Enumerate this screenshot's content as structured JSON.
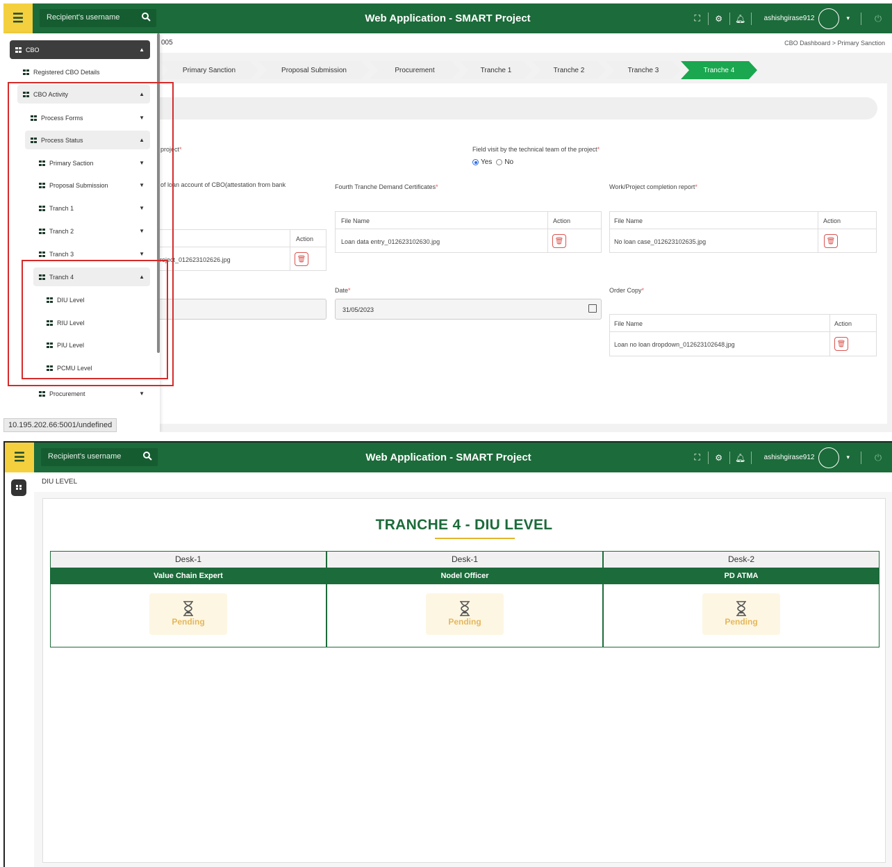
{
  "app": {
    "title": "Web Application - SMART Project",
    "search_placeholder": "Recipient's username",
    "username": "ashishgirase912"
  },
  "screen1": {
    "breadcrumb_left": "005",
    "breadcrumb_right": "CBO Dashboard  >  Primary Sanction",
    "steps": [
      "Primary Sanction",
      "Proposal Submission",
      "Procurement",
      "Tranche 1",
      "Tranche 2",
      "Tranche 3",
      "Tranche 4"
    ],
    "active_step": "Tranche 4",
    "fields": {
      "project_label_partial": "project",
      "field_visit_label": "Field visit by the technical team of the project",
      "radio_yes": "Yes",
      "radio_no": "No",
      "loan_account_label_partial": "of loan account of CBO(attestation from bank",
      "fourth_tranche_label": "Fourth Tranche Demand Certificates",
      "completion_report_label": "Work/Project completion report",
      "date_label": "Date",
      "date_value": "31/05/2023",
      "order_copy_label": "Order Copy"
    },
    "tables": {
      "col_file_name": "File Name",
      "col_action": "Action",
      "left_file_partial": "roject_012623102626.jpg",
      "fourth_tranche_file": "Loan data entry_012623102630.jpg",
      "completion_file": "No loan case_012623102635.jpg",
      "order_copy_file": "Loan no loan dropdown_012623102648.jpg"
    },
    "sidebar": {
      "cbo": "CBO",
      "registered": "Registered CBO Details",
      "activity": "CBO Activity",
      "process_forms": "Process Forms",
      "process_status": "Process Status",
      "primary_saction": "Primary Saction",
      "proposal_submission": "Proposal Submission",
      "tranch1": "Tranch 1",
      "tranch2": "Tranch 2",
      "tranch3": "Tranch 3",
      "tranch4": "Tranch 4",
      "diu": "DIU Level",
      "riu": "RIU Level",
      "piu": "PIU Level",
      "pcmu": "PCMU Level",
      "procurement": "Procurement"
    },
    "status_url": "10.195.202.66:5001/undefined"
  },
  "screen2": {
    "page_header": "DIU LEVEL",
    "title": "TRANCHE 4 - DIU LEVEL",
    "desks": [
      {
        "desk": "Desk-1",
        "role": "Value Chain Expert",
        "status": "Pending"
      },
      {
        "desk": "Desk-1",
        "role": "Nodel Officer",
        "status": "Pending"
      },
      {
        "desk": "Desk-2",
        "role": "PD ATMA",
        "status": "Pending"
      }
    ]
  },
  "colors": {
    "brand_green": "#1c6b3a",
    "accent_yellow": "#f4d03f",
    "active_step": "#1aa74f",
    "highlight_red": "#d62a2a",
    "pending_text": "#e5b75a"
  }
}
